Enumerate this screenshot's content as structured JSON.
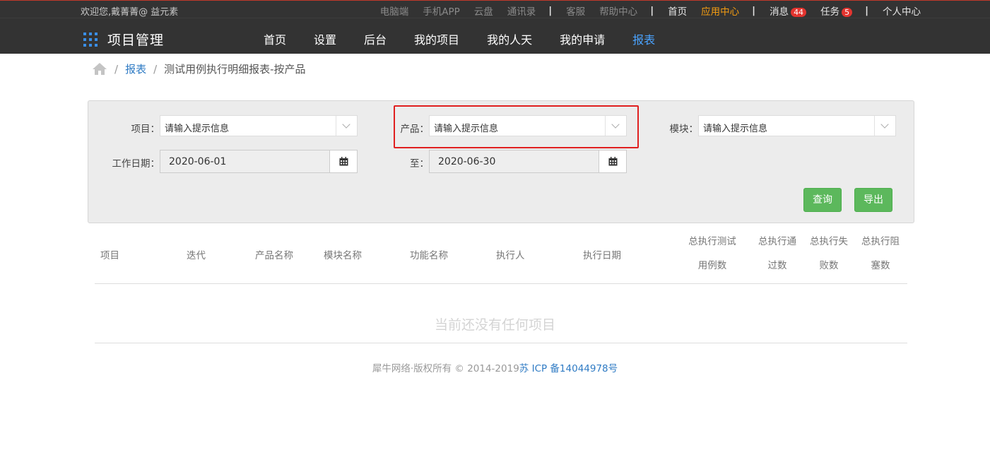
{
  "topbar": {
    "welcome": "欢迎您,戴菁菁@ 益元素",
    "links_left": [
      "电脑端",
      "手机APP",
      "云盘",
      "通讯录"
    ],
    "links_mid": [
      "客服",
      "帮助中心"
    ],
    "home": "首页",
    "app_center": "应用中心",
    "messages": "消息",
    "messages_count": "44",
    "tasks": "任务",
    "tasks_count": "5",
    "profile": "个人中心",
    "separator": "|"
  },
  "navbar": {
    "brand": "项目管理",
    "menu": [
      "首页",
      "设置",
      "后台",
      "我的项目",
      "我的人天",
      "我的申请",
      "报表"
    ]
  },
  "breadcrumb": {
    "sep": "/",
    "link": "报表",
    "current": "测试用例执行明细报表-按产品"
  },
  "filters": {
    "project_label": "项目：",
    "project_placeholder": "请输入提示信息",
    "product_label": "产品：",
    "product_placeholder": "请输入提示信息",
    "module_label": "模块：",
    "module_placeholder": "请输入提示信息",
    "workdate_label": "工作日期：",
    "date_from": "2020-06-01",
    "to_label": "至：",
    "date_to": "2020-06-30",
    "query_button": "查询",
    "export_button": "导出"
  },
  "table": {
    "headers": [
      "项目",
      "迭代",
      "产品名称",
      "模块名称",
      "功能名称",
      "执行人",
      "执行日期"
    ],
    "headers_multi": [
      [
        "总执行测试",
        "用例数"
      ],
      [
        "总执行通",
        "过数"
      ],
      [
        "总执行失",
        "败数"
      ],
      [
        "总执行阻",
        "塞数"
      ]
    ],
    "empty_text": "当前还没有任何项目"
  },
  "footer": {
    "copyright": "犀牛网络·版权所有 © 2014-2019",
    "icp": "苏 ICP 备14044978号"
  },
  "colors": {
    "dark_bar": "#333333",
    "accent_blue": "#4aa3ff",
    "orange": "#f39c12",
    "badge_red": "#e3342f",
    "button_green": "#5cb85c",
    "highlight_red": "#e02020"
  }
}
